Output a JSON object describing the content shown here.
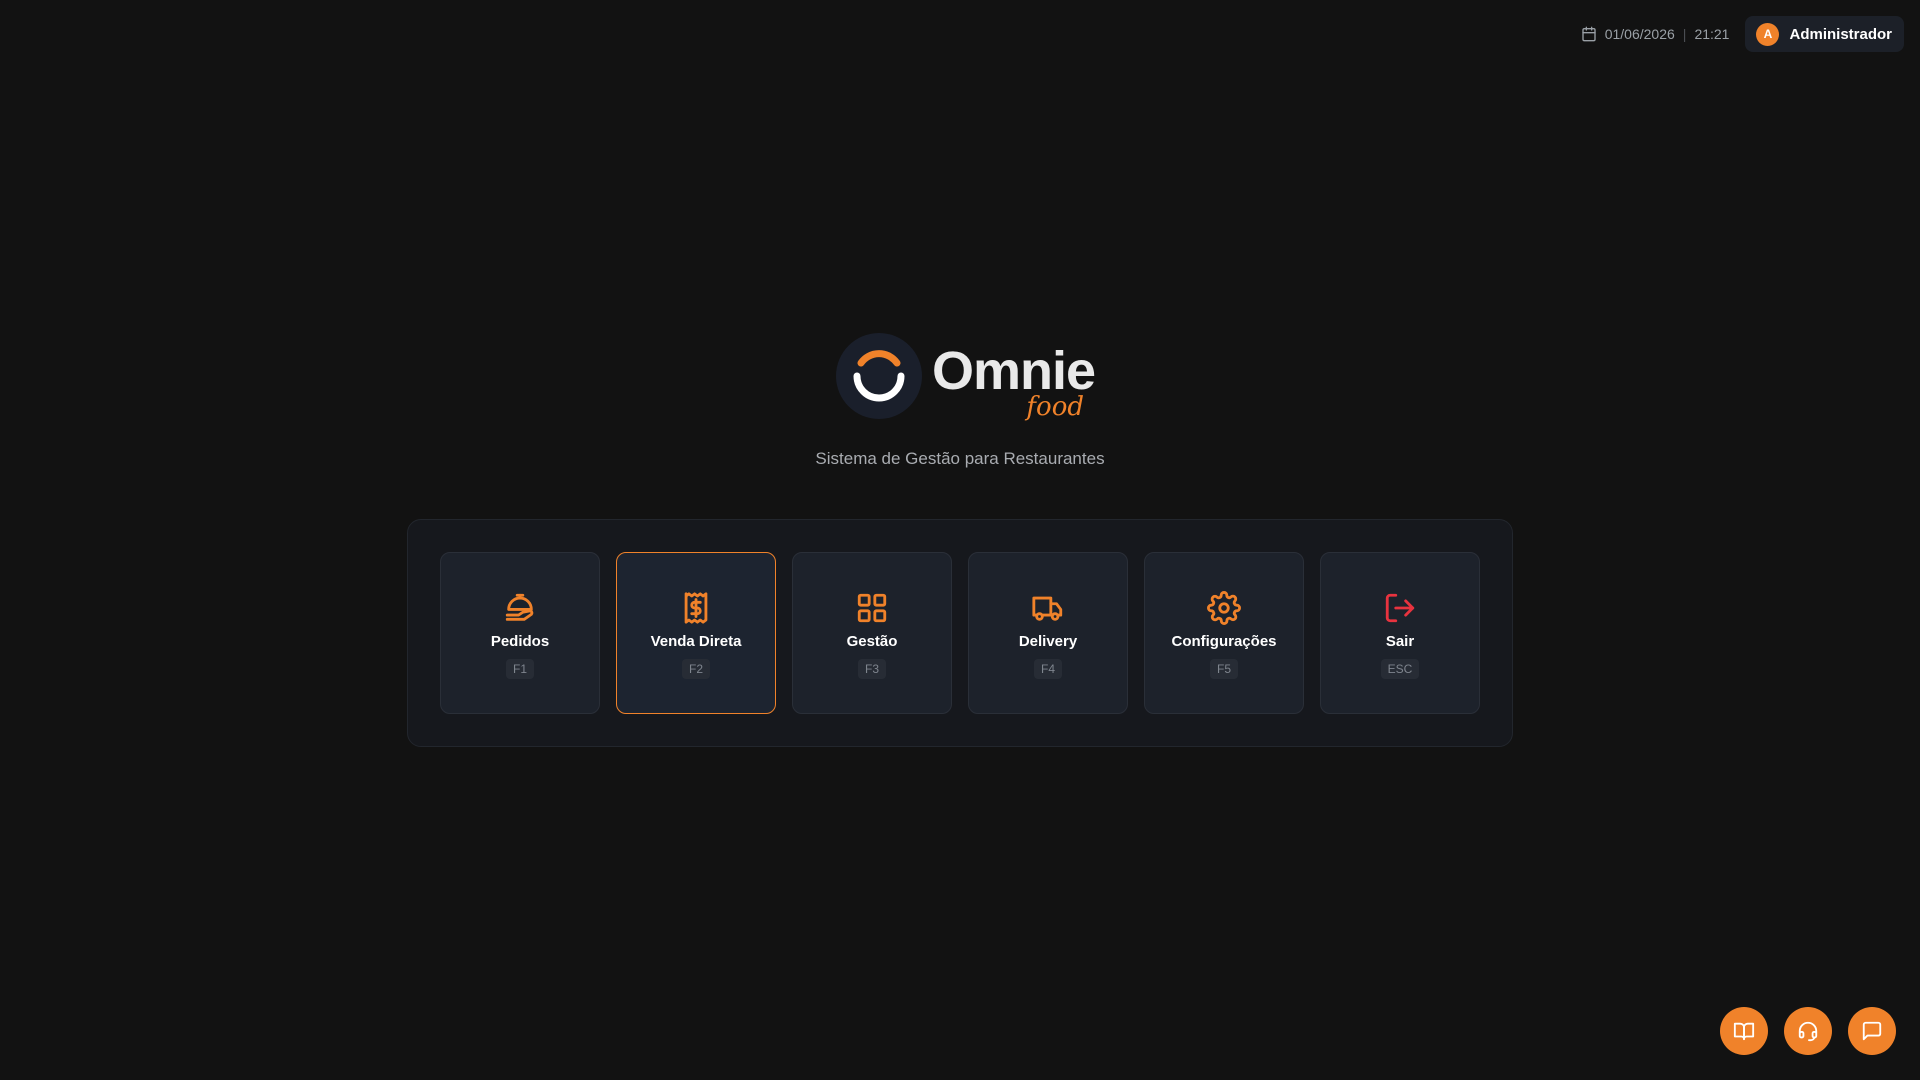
{
  "header": {
    "date": "01/06/2026",
    "separator": "|",
    "time": "21:21",
    "user": {
      "initial": "A",
      "name": "Administrador"
    }
  },
  "brand": {
    "name": "Omnie",
    "sub": "food",
    "tagline": "Sistema de Gestão para Restaurantes"
  },
  "menu": [
    {
      "label": "Pedidos",
      "key": "F1",
      "icon": "food-serving-icon",
      "active": false
    },
    {
      "label": "Venda Direta",
      "key": "F2",
      "icon": "receipt-dollar-icon",
      "active": true
    },
    {
      "label": "Gestão",
      "key": "F3",
      "icon": "grid-icon",
      "active": false
    },
    {
      "label": "Delivery",
      "key": "F4",
      "icon": "truck-icon",
      "active": false
    },
    {
      "label": "Configurações",
      "key": "F5",
      "icon": "gear-icon",
      "active": false
    },
    {
      "label": "Sair",
      "key": "ESC",
      "icon": "logout-icon",
      "active": false
    }
  ],
  "fabs": [
    {
      "icon": "book-icon"
    },
    {
      "icon": "headset-icon"
    },
    {
      "icon": "chat-icon"
    }
  ],
  "colors": {
    "accent": "#f0822a",
    "danger": "#e8333f",
    "background": "#121212",
    "card": "#1d222b"
  }
}
